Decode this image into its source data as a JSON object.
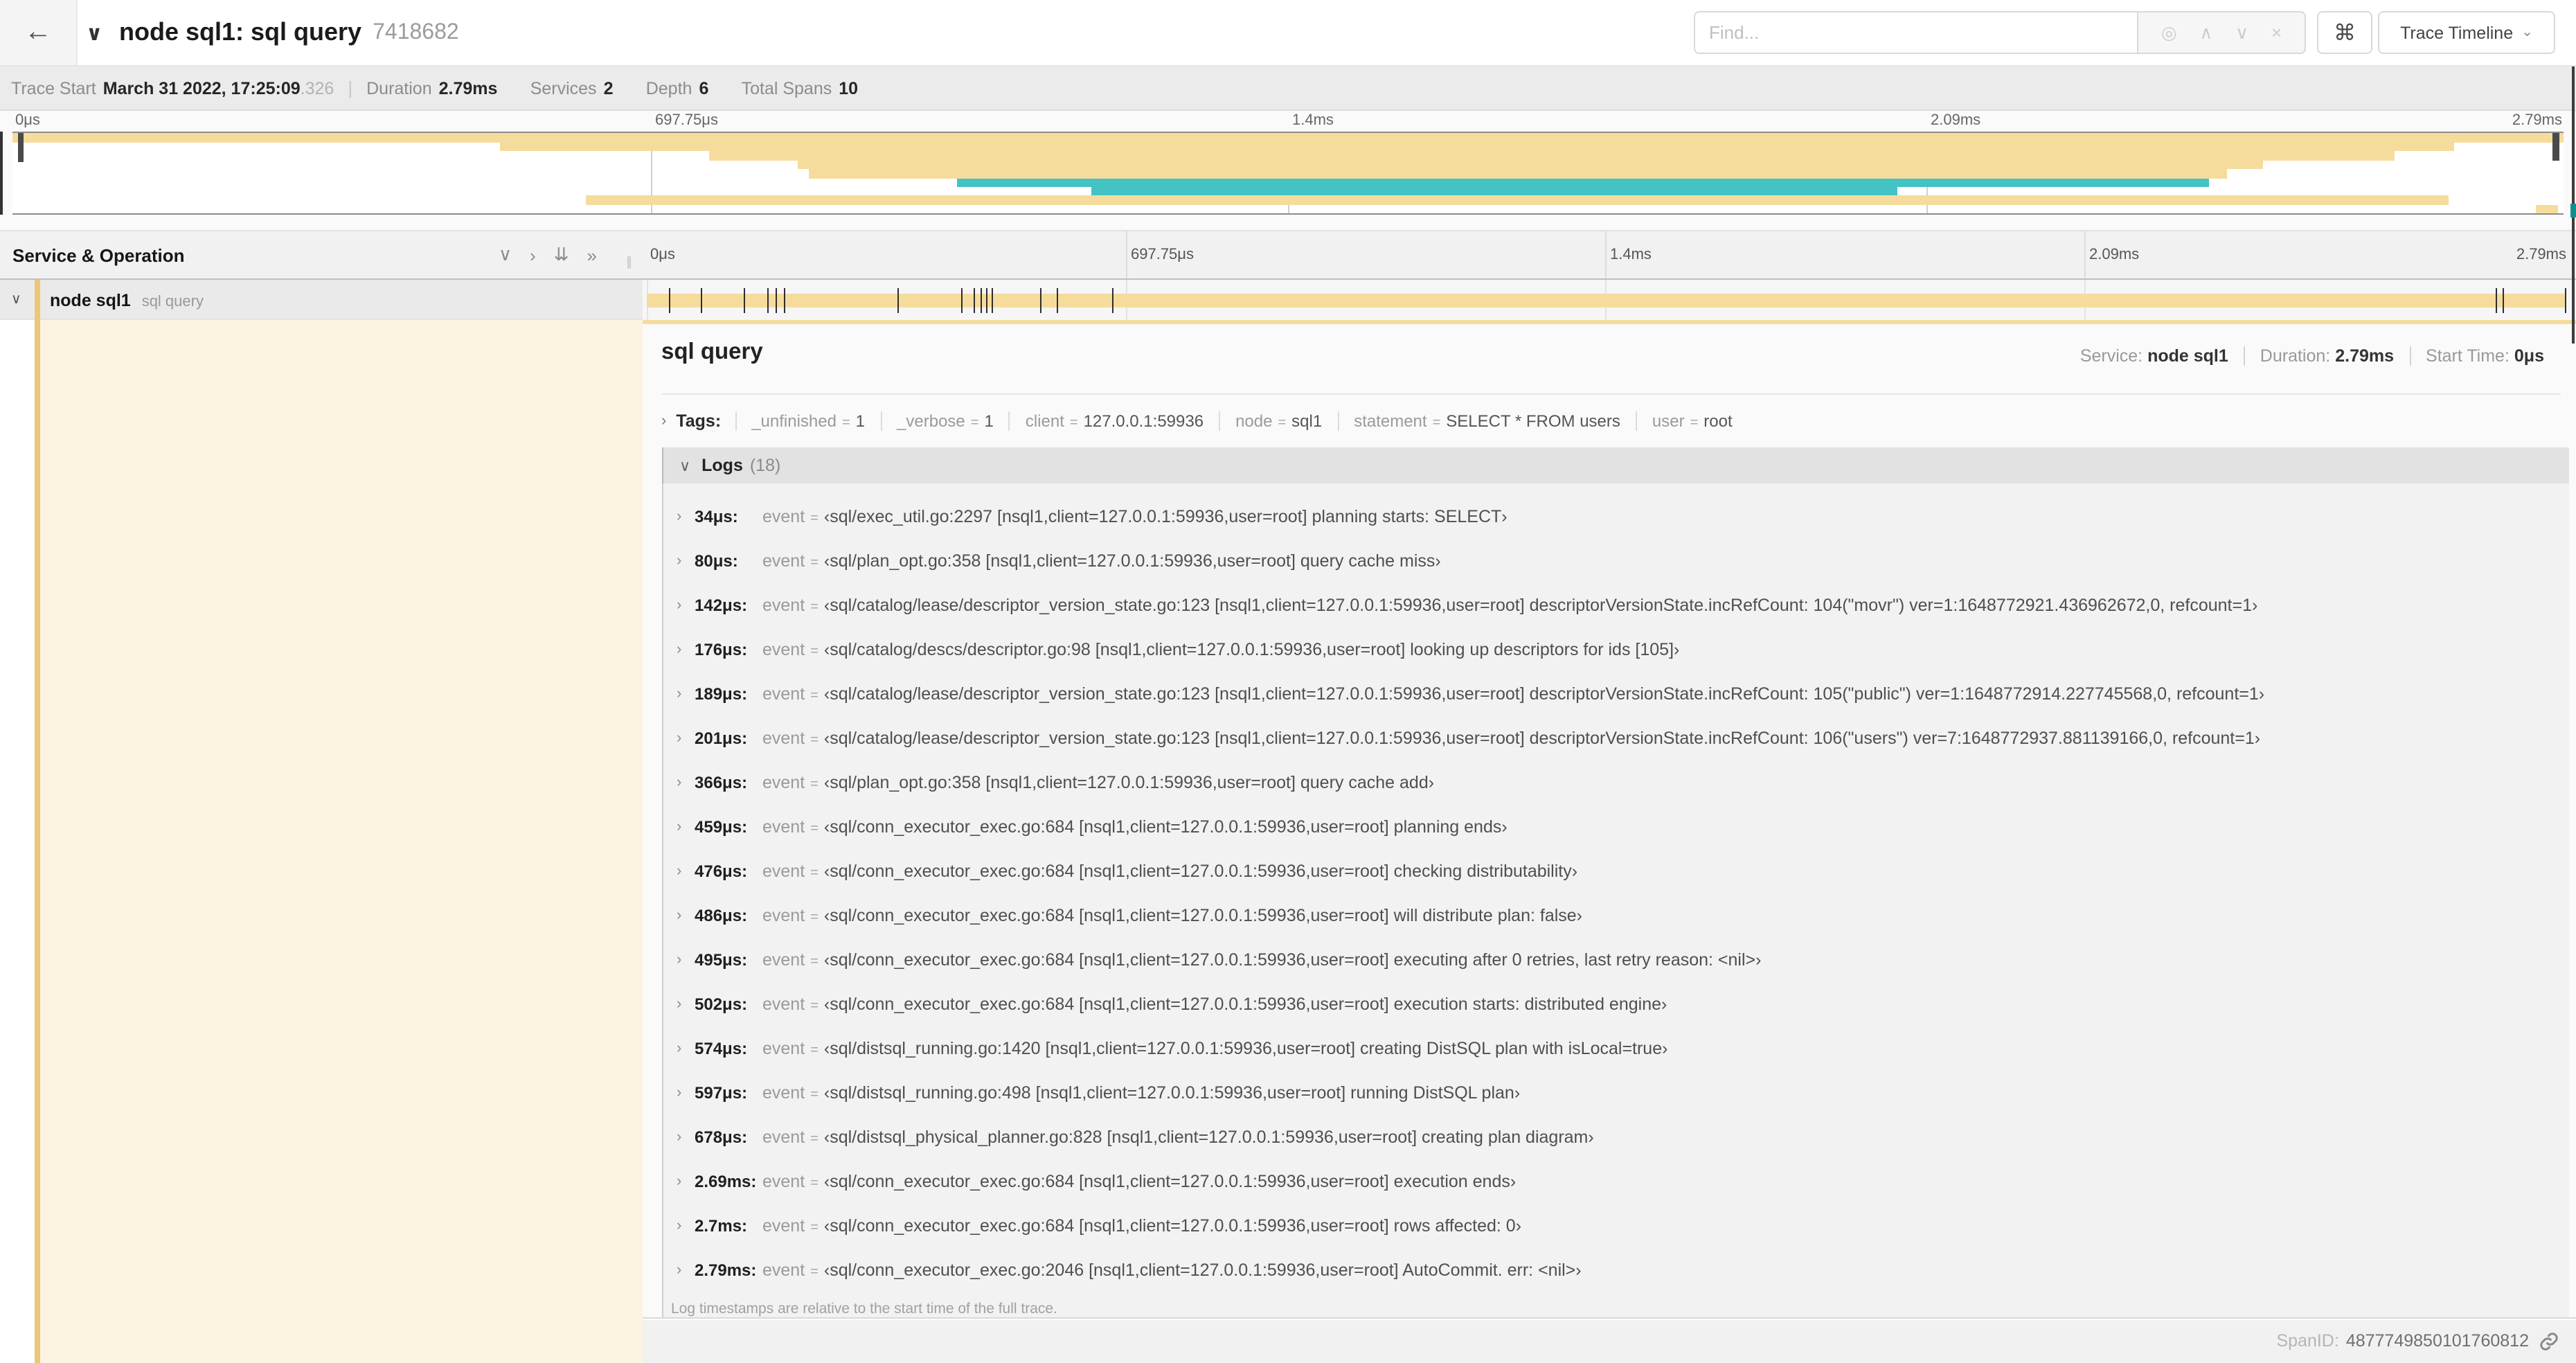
{
  "header": {
    "back_icon": "←",
    "collapse_icon": "∨",
    "title": "node sql1: sql query",
    "trace_id": "7418682",
    "find_placeholder": "Find...",
    "find_icons": {
      "locate": "◎",
      "prev": "∧",
      "next": "∨",
      "clear": "×"
    },
    "shortcuts_label": "⌘",
    "view_selector": "Trace Timeline",
    "view_caret": "⌄"
  },
  "summary": {
    "trace_start_label": "Trace Start",
    "trace_start_value": "March 31 2022, 17:25:09",
    "trace_start_ms": ".326",
    "duration_label": "Duration",
    "duration_value": "2.79ms",
    "services_label": "Services",
    "services_value": "2",
    "depth_label": "Depth",
    "depth_value": "6",
    "total_spans_label": "Total Spans",
    "total_spans_value": "10"
  },
  "minimap": {
    "axis_labels": [
      "0μs",
      "697.75μs",
      "1.4ms",
      "2.09ms",
      "2.79ms"
    ],
    "rows": [
      {
        "left": 0,
        "width": 100,
        "color": "tan"
      },
      {
        "left": 19.1,
        "width": 76.6,
        "color": "tan"
      },
      {
        "left": 27.3,
        "width": 66.1,
        "color": "tan"
      },
      {
        "left": 30.8,
        "width": 57.4,
        "color": "tan"
      },
      {
        "left": 31.2,
        "width": 55.6,
        "color": "tan"
      },
      {
        "left": 37.0,
        "width": 49.1,
        "color": "teal"
      },
      {
        "left": 42.3,
        "width": 31.6,
        "color": "teal"
      },
      {
        "left": 22.5,
        "width": 73.0,
        "color": "tan"
      },
      {
        "left": 98.9,
        "width": 0.9,
        "color": "tan"
      }
    ]
  },
  "timeline": {
    "header_label": "Service & Operation",
    "header_icons": [
      "∨",
      "›",
      "⇊",
      "»"
    ],
    "ruler_labels": [
      "0μs",
      "697.75μs",
      "1.4ms",
      "2.09ms",
      "2.79ms"
    ],
    "row": {
      "chevron": "∨",
      "service": "node sql1",
      "operation": "sql query"
    },
    "duration_us": 2790,
    "log_tick_us": [
      34,
      80,
      142,
      176,
      189,
      201,
      366,
      459,
      476,
      486,
      495,
      502,
      574,
      597,
      678,
      2690,
      2700,
      2790
    ]
  },
  "detail": {
    "title": "sql query",
    "meta": [
      {
        "label": "Service:",
        "value": "node sql1"
      },
      {
        "label": "Duration:",
        "value": "2.79ms"
      },
      {
        "label": "Start Time:",
        "value": "0μs"
      }
    ],
    "tags_chevron": "›",
    "tags_label": "Tags:",
    "tag_eq": "=",
    "tags": [
      {
        "key": "_unfinished",
        "value": "1"
      },
      {
        "key": "_verbose",
        "value": "1"
      },
      {
        "key": "client",
        "value": "127.0.0.1:59936"
      },
      {
        "key": "node",
        "value": "sql1"
      },
      {
        "key": "statement",
        "value": "SELECT * FROM users"
      },
      {
        "key": "user",
        "value": "root"
      }
    ],
    "logs_chevron": "∨",
    "logs_label": "Logs",
    "logs_count": "(18)",
    "log_eq": "=",
    "row_chevron": "›",
    "logs": [
      {
        "time": "34μs:",
        "key": "event",
        "message": "‹sql/exec_util.go:2297 [nsql1,client=127.0.0.1:59936,user=root] planning starts: SELECT›"
      },
      {
        "time": "80μs:",
        "key": "event",
        "message": "‹sql/plan_opt.go:358 [nsql1,client=127.0.0.1:59936,user=root] query cache miss›"
      },
      {
        "time": "142μs:",
        "key": "event",
        "message": "‹sql/catalog/lease/descriptor_version_state.go:123 [nsql1,client=127.0.0.1:59936,user=root] descriptorVersionState.incRefCount: 104(\"movr\") ver=1:1648772921.436962672,0, refcount=1›"
      },
      {
        "time": "176μs:",
        "key": "event",
        "message": "‹sql/catalog/descs/descriptor.go:98 [nsql1,client=127.0.0.1:59936,user=root] looking up descriptors for ids [105]›"
      },
      {
        "time": "189μs:",
        "key": "event",
        "message": "‹sql/catalog/lease/descriptor_version_state.go:123 [nsql1,client=127.0.0.1:59936,user=root] descriptorVersionState.incRefCount: 105(\"public\") ver=1:1648772914.227745568,0, refcount=1›"
      },
      {
        "time": "201μs:",
        "key": "event",
        "message": "‹sql/catalog/lease/descriptor_version_state.go:123 [nsql1,client=127.0.0.1:59936,user=root] descriptorVersionState.incRefCount: 106(\"users\") ver=7:1648772937.881139166,0, refcount=1›"
      },
      {
        "time": "366μs:",
        "key": "event",
        "message": "‹sql/plan_opt.go:358 [nsql1,client=127.0.0.1:59936,user=root] query cache add›"
      },
      {
        "time": "459μs:",
        "key": "event",
        "message": "‹sql/conn_executor_exec.go:684 [nsql1,client=127.0.0.1:59936,user=root] planning ends›"
      },
      {
        "time": "476μs:",
        "key": "event",
        "message": "‹sql/conn_executor_exec.go:684 [nsql1,client=127.0.0.1:59936,user=root] checking distributability›"
      },
      {
        "time": "486μs:",
        "key": "event",
        "message": "‹sql/conn_executor_exec.go:684 [nsql1,client=127.0.0.1:59936,user=root] will distribute plan: false›"
      },
      {
        "time": "495μs:",
        "key": "event",
        "message": "‹sql/conn_executor_exec.go:684 [nsql1,client=127.0.0.1:59936,user=root] executing after 0 retries, last retry reason: <nil>›"
      },
      {
        "time": "502μs:",
        "key": "event",
        "message": "‹sql/conn_executor_exec.go:684 [nsql1,client=127.0.0.1:59936,user=root] execution starts: distributed engine›"
      },
      {
        "time": "574μs:",
        "key": "event",
        "message": "‹sql/distsql_running.go:1420 [nsql1,client=127.0.0.1:59936,user=root] creating DistSQL plan with isLocal=true›"
      },
      {
        "time": "597μs:",
        "key": "event",
        "message": "‹sql/distsql_running.go:498 [nsql1,client=127.0.0.1:59936,user=root] running DistSQL plan›"
      },
      {
        "time": "678μs:",
        "key": "event",
        "message": "‹sql/distsql_physical_planner.go:828 [nsql1,client=127.0.0.1:59936,user=root] creating plan diagram›"
      },
      {
        "time": "2.69ms:",
        "key": "event",
        "message": "‹sql/conn_executor_exec.go:684 [nsql1,client=127.0.0.1:59936,user=root] execution ends›"
      },
      {
        "time": "2.7ms:",
        "key": "event",
        "message": "‹sql/conn_executor_exec.go:684 [nsql1,client=127.0.0.1:59936,user=root] rows affected: 0›"
      },
      {
        "time": "2.79ms:",
        "key": "event",
        "message": "‹sql/conn_executor_exec.go:2046 [nsql1,client=127.0.0.1:59936,user=root] AutoCommit. err: <nil>›"
      }
    ],
    "footer_note": "Log timestamps are relative to the start time of the full trace.",
    "span_id_label": "SpanID:",
    "span_id": "4877749850101760812"
  },
  "colors": {
    "tan": "#F6DC9C",
    "teal": "#43C3C3",
    "stripe": "#EDC678",
    "cream": "#FCF4E1"
  }
}
